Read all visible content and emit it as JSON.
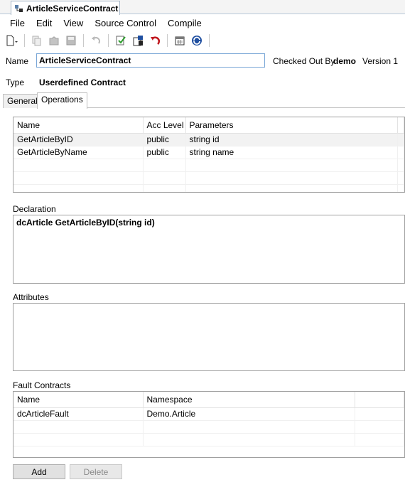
{
  "doc_tab": {
    "title": "ArticleServiceContract"
  },
  "menu": [
    "File",
    "Edit",
    "View",
    "Source Control",
    "Compile"
  ],
  "toolbar": {
    "icons": [
      "new-icon",
      "copy-icon",
      "puzzle-icon",
      "save-icon",
      "undo-icon",
      "check-in-icon",
      "check-out-icon",
      "revert-icon",
      "calendar-icon",
      "sync-icon"
    ]
  },
  "header": {
    "name_label": "Name",
    "name_value": "ArticleServiceContract",
    "checked_out_label": "Checked Out By",
    "checked_out_user": "demo",
    "version": "Version 1",
    "type_label": "Type",
    "type_value": "Userdefined Contract"
  },
  "tabs": [
    "General",
    "Operations"
  ],
  "operations": {
    "columns": [
      "Name",
      "Acc Level",
      "Parameters"
    ],
    "rows": [
      [
        "GetArticleByID",
        "public",
        "string id"
      ],
      [
        "GetArticleByName",
        "public",
        "string name"
      ]
    ]
  },
  "declaration": {
    "label": "Declaration",
    "value": "dcArticle GetArticleByID(string id)"
  },
  "attributes": {
    "label": "Attributes"
  },
  "fault_contracts": {
    "label": "Fault Contracts",
    "columns": [
      "Name",
      "Namespace"
    ],
    "rows": [
      [
        "dcArticleFault",
        "Demo.Article"
      ]
    ]
  },
  "buttons": {
    "add": "Add",
    "delete": "Delete"
  }
}
